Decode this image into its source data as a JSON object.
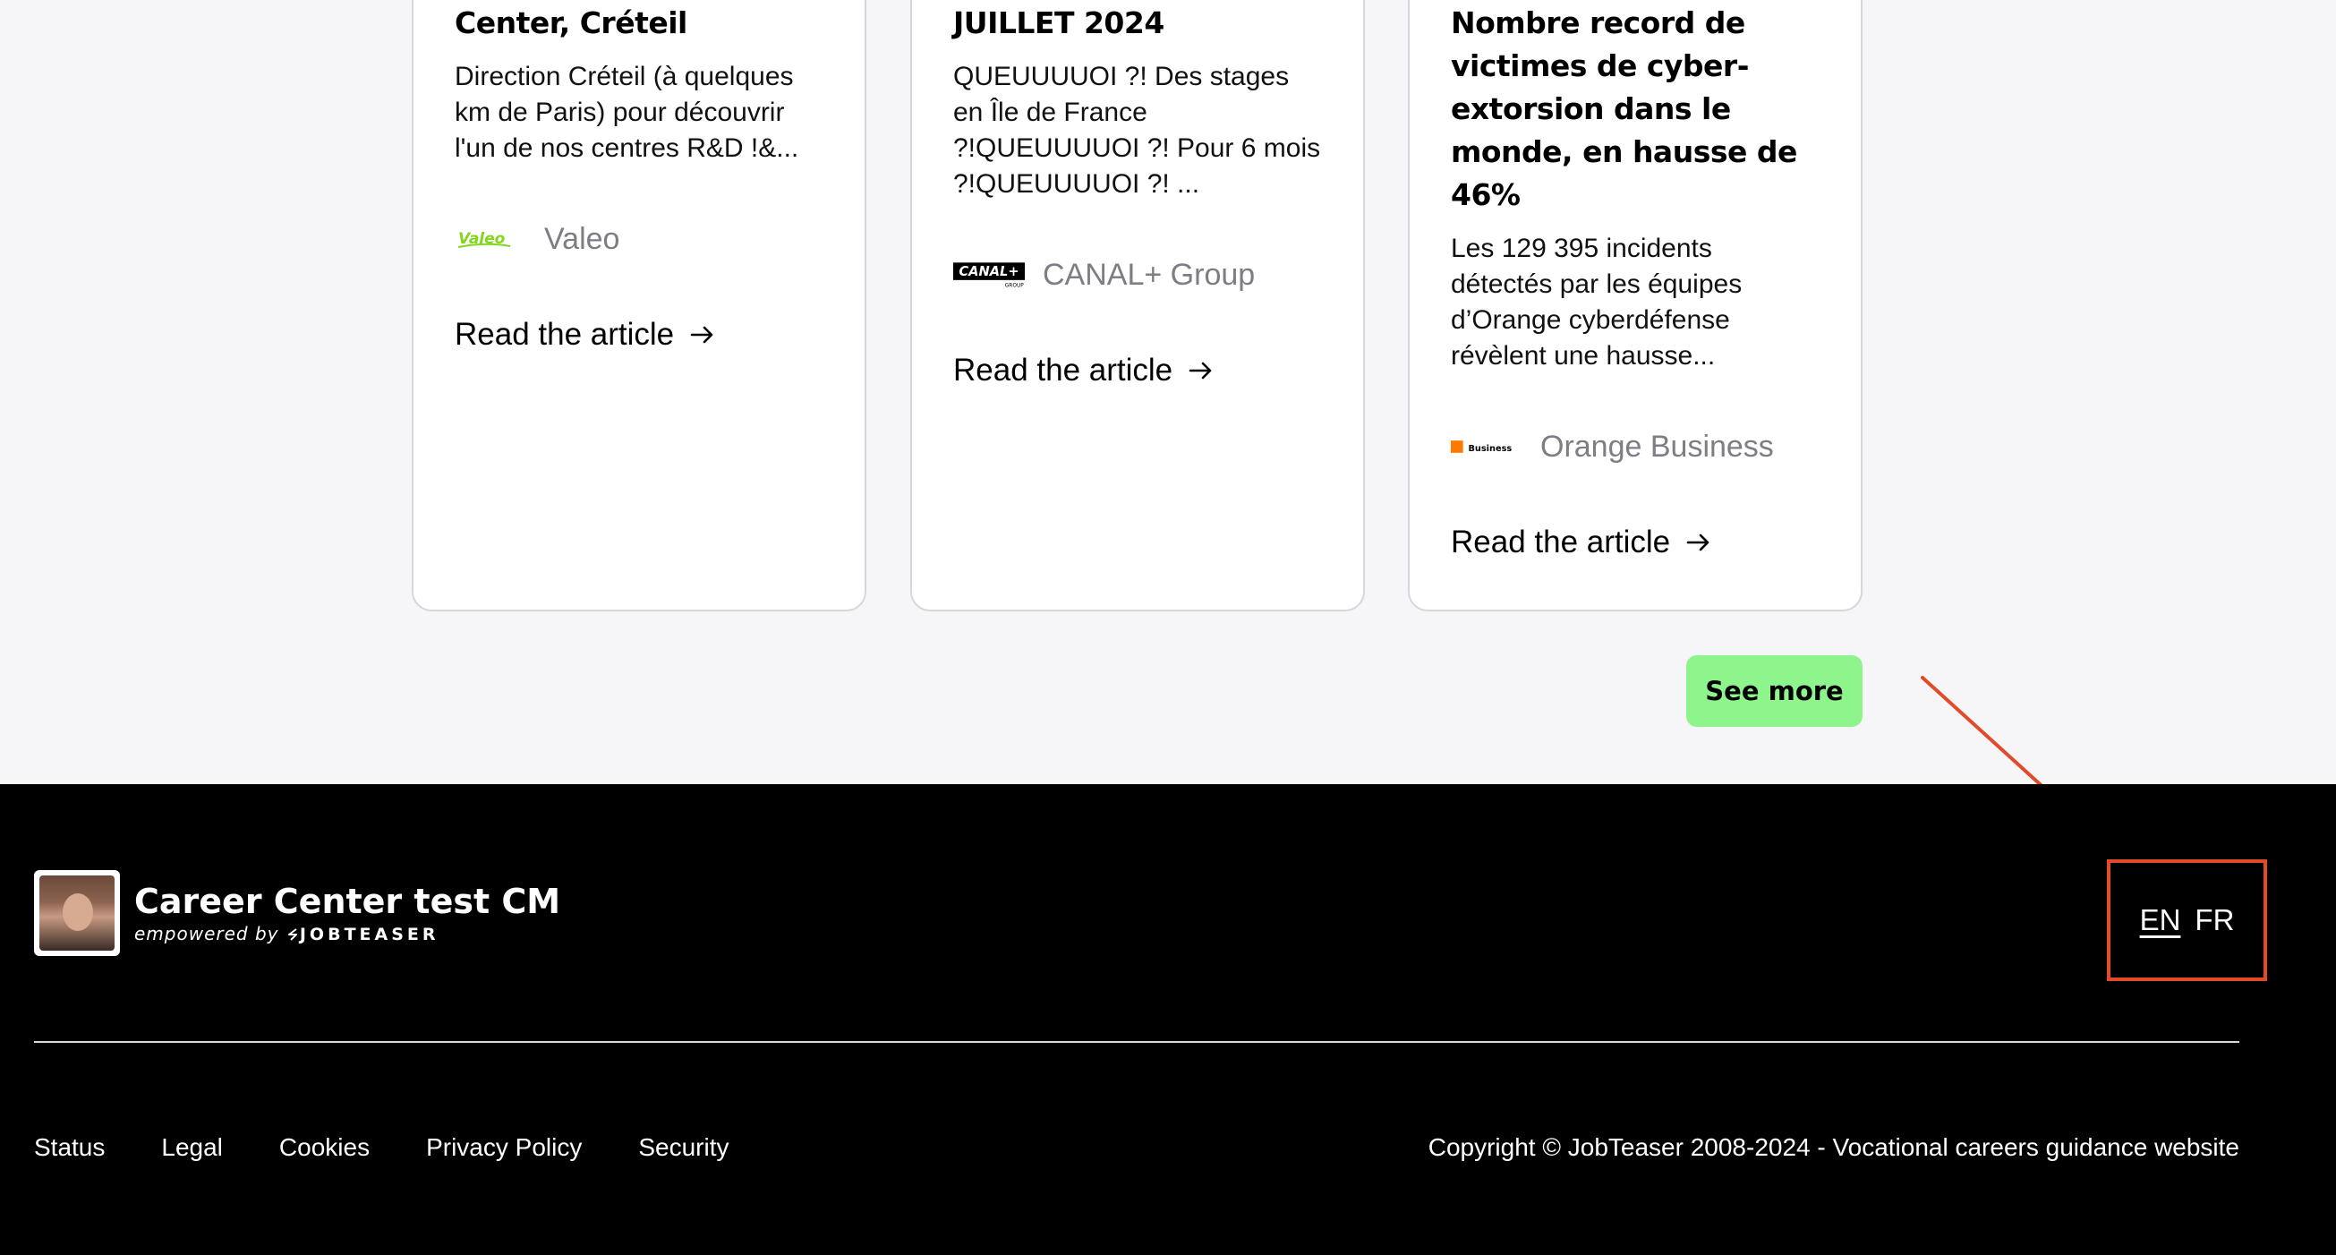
{
  "cards": [
    {
      "title": "Center, Créteil",
      "excerpt": "Direction Créteil (à quelques km de Paris) pour découvrir l'un de nos centres R&D !&...",
      "logo_text": "Valeo",
      "company": "Valeo",
      "read_label": "Read the article"
    },
    {
      "title": "JUILLET 2024",
      "excerpt": "QUEUUUUOI ?! Des stages en Île de France ?!QUEUUUUOI ?! Pour 6 mois ?!QUEUUUUOI ?! ...",
      "logo_text": "CANAL+",
      "logo_sub": "GROUP",
      "company": "CANAL+ Group",
      "read_label": "Read the article"
    },
    {
      "title": "Nombre record de victimes de cyber-extorsion dans le monde, en hausse de 46%",
      "excerpt": "Les 129 395 incidents détectés par les équipes d’Orange cyberdéfense révèlent une hausse...",
      "logo_text": "Business",
      "company": "Orange Business",
      "read_label": "Read the article"
    }
  ],
  "see_more_label": "See more",
  "footer": {
    "brand_name": "Career Center test CM",
    "empowered_by": "empowered by",
    "jobteaser": "JOBTEASER",
    "languages": [
      "EN",
      "FR"
    ],
    "active_language": "EN",
    "links": [
      "Status",
      "Legal",
      "Cookies",
      "Privacy Policy",
      "Security"
    ],
    "copyright": "Copyright © JobTeaser 2008-2024 - Vocational careers guidance website"
  },
  "colors": {
    "see_more_bg": "#8ef58c",
    "annotation": "#e34a2c",
    "footer_bg": "#000000",
    "company_text": "#7d7d86"
  },
  "icons": {
    "read_arrow": "arrow-right-icon",
    "annotation": "annotation-arrow-icon"
  }
}
